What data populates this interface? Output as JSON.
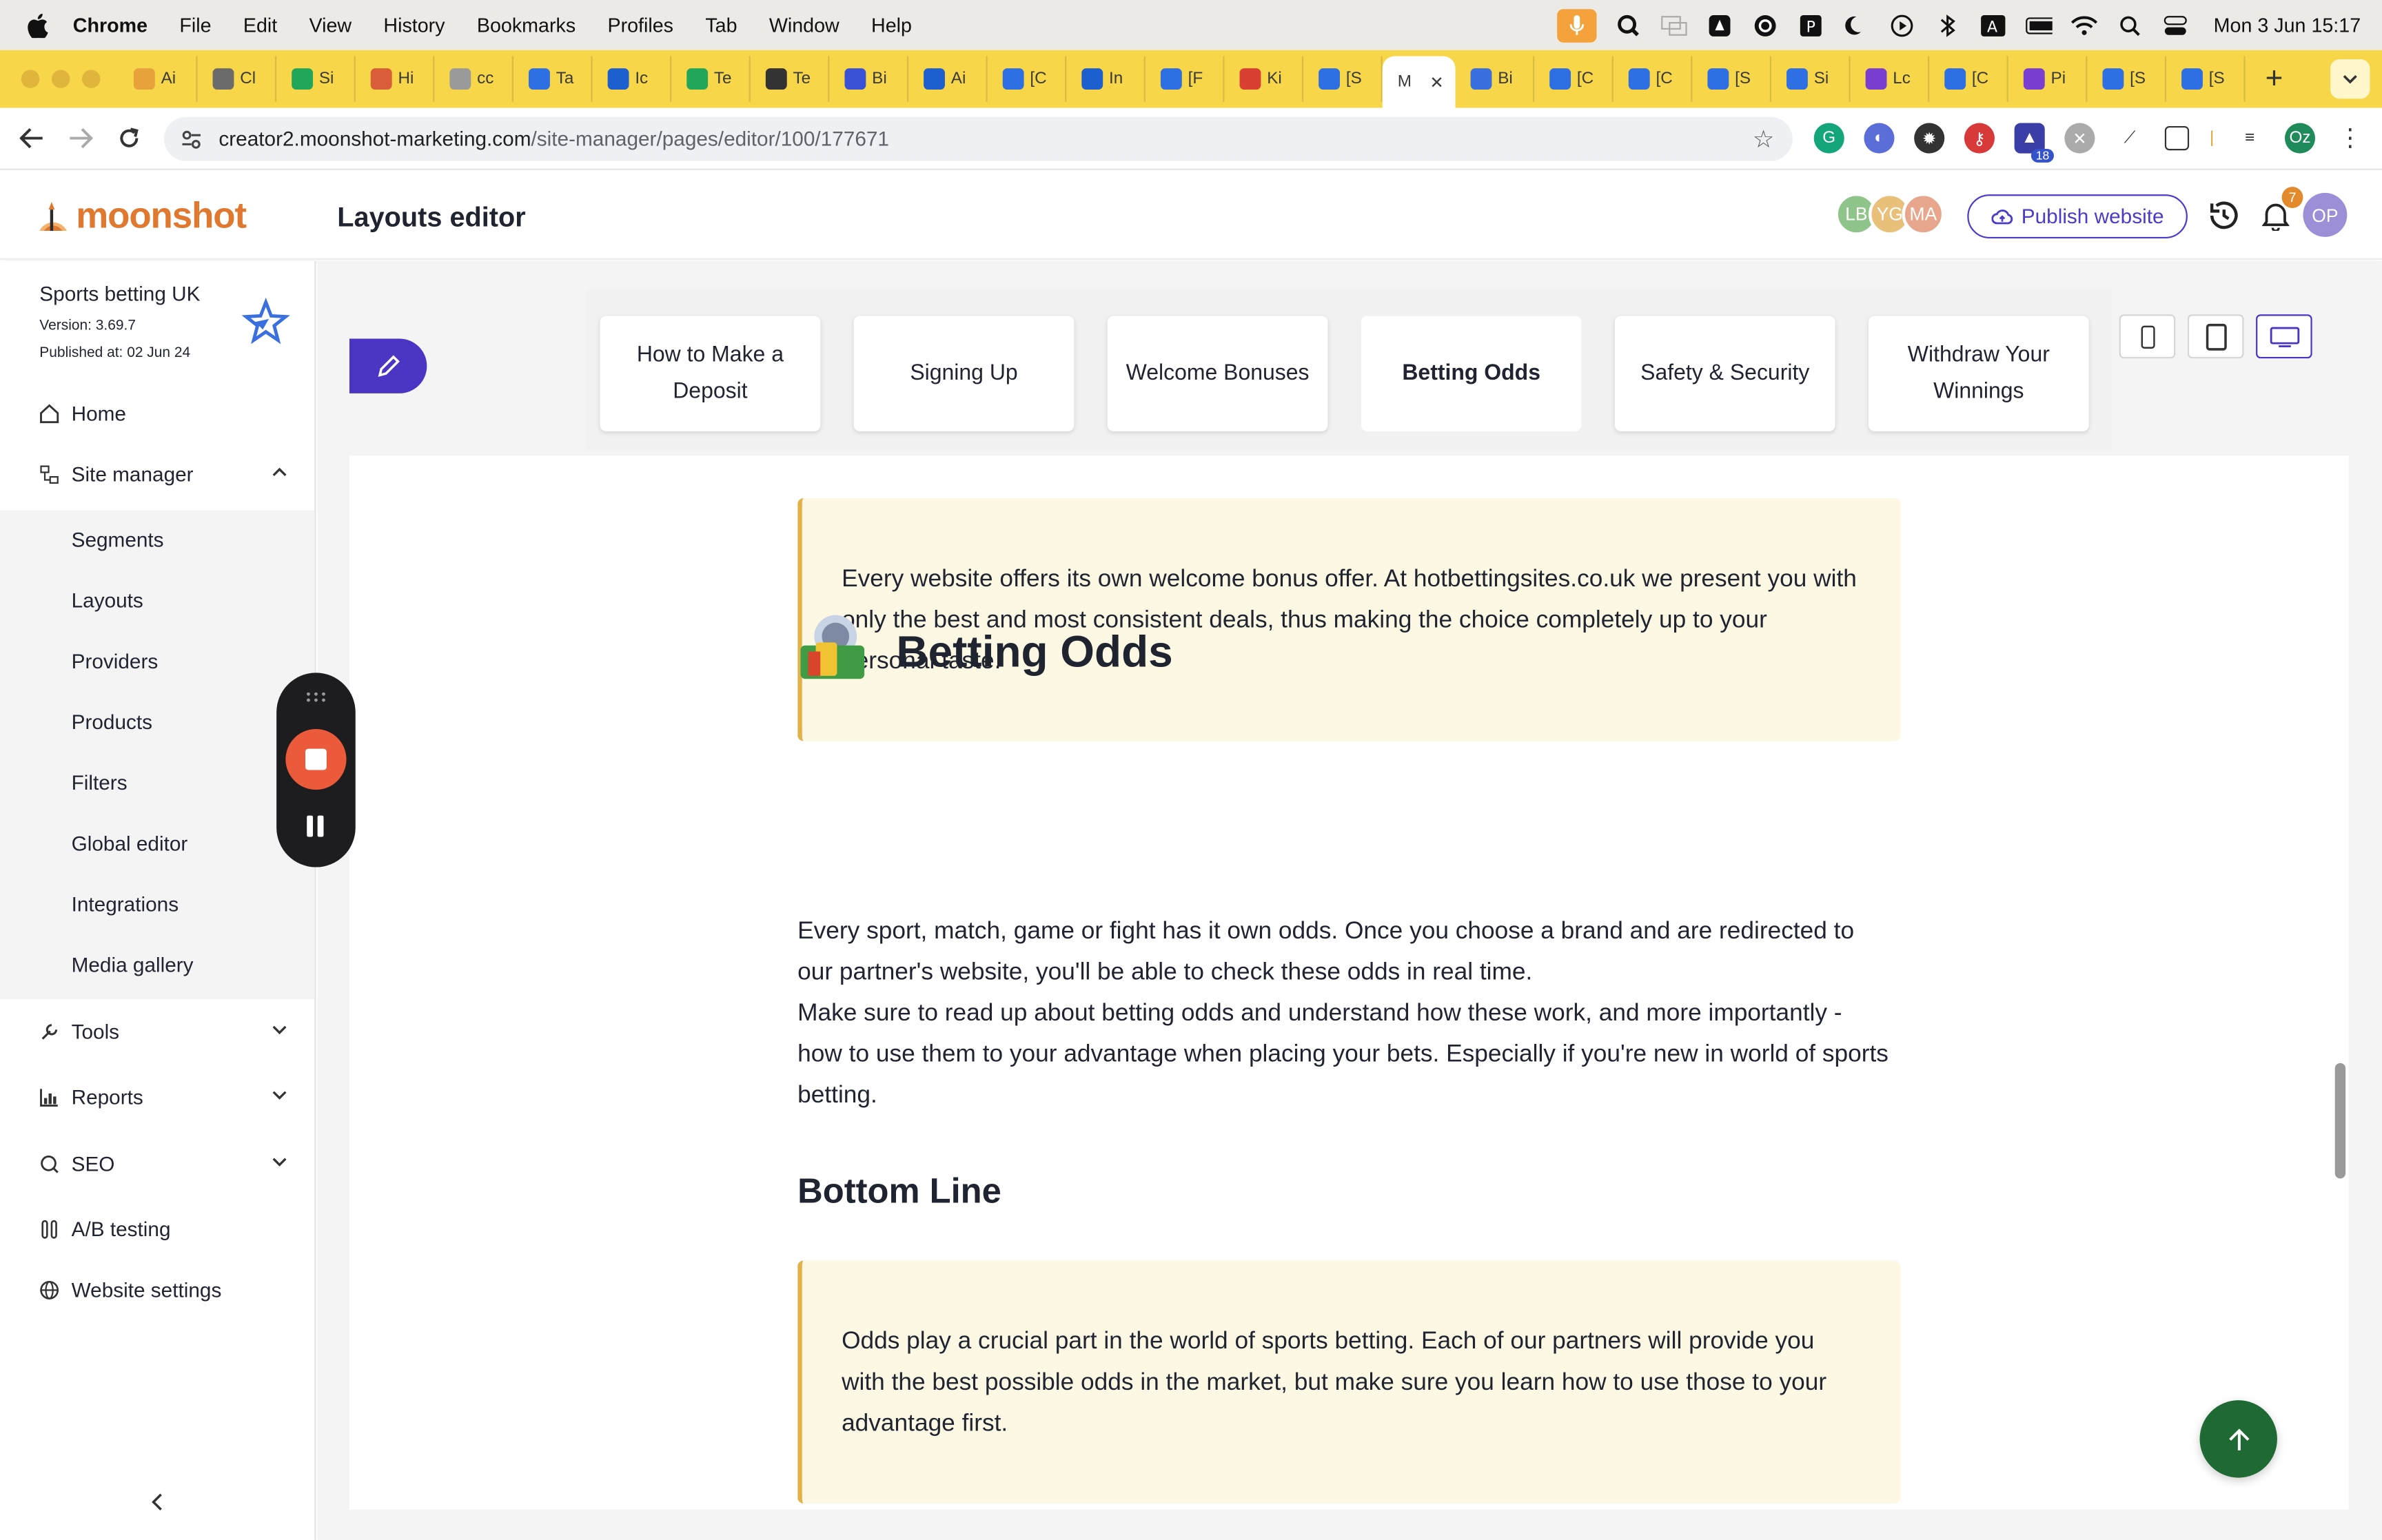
{
  "menubar": {
    "app": "Chrome",
    "items": [
      "File",
      "Edit",
      "View",
      "History",
      "Bookmarks",
      "Profiles",
      "Tab",
      "Window",
      "Help"
    ],
    "clock": "Mon 3 Jun  15:17"
  },
  "tabs": [
    {
      "label": "Ai",
      "color": "#e8a23b"
    },
    {
      "label": "Cl",
      "color": "#6b6b6b"
    },
    {
      "label": "Si",
      "color": "#22a65a"
    },
    {
      "label": "Hi",
      "color": "#d95d39"
    },
    {
      "label": "cc",
      "color": "#9a9a9a"
    },
    {
      "label": "Ta",
      "color": "#2f6fe4"
    },
    {
      "label": "Ic",
      "color": "#1e5fcf"
    },
    {
      "label": "Te",
      "color": "#22a65a"
    },
    {
      "label": "Te",
      "color": "#333333"
    },
    {
      "label": "Bi",
      "color": "#3a53d6"
    },
    {
      "label": "Ai",
      "color": "#1e5fcf"
    },
    {
      "label": "[C",
      "color": "#2f6fe4"
    },
    {
      "label": "In",
      "color": "#1e5fcf"
    },
    {
      "label": "[F",
      "color": "#2f6fe4"
    },
    {
      "label": "Ki",
      "color": "#d94032"
    },
    {
      "label": "[S",
      "color": "#2f6fe4"
    },
    {
      "label": "M",
      "color": "#ffffff",
      "active": true
    },
    {
      "label": "Bi",
      "color": "#3a6fe0"
    },
    {
      "label": "[C",
      "color": "#2f6fe4"
    },
    {
      "label": "[C",
      "color": "#2f6fe4"
    },
    {
      "label": "[S",
      "color": "#2f6fe4"
    },
    {
      "label": "Si",
      "color": "#2f6fe4"
    },
    {
      "label": "Lc",
      "color": "#7a3fd1"
    },
    {
      "label": "[C",
      "color": "#2f6fe4"
    },
    {
      "label": "Pi",
      "color": "#7a3fd1"
    },
    {
      "label": "[S",
      "color": "#2f6fe4"
    },
    {
      "label": "[S",
      "color": "#2f6fe4"
    }
  ],
  "address": {
    "host": "creator2.moonshot-marketing.com",
    "path": "/site-manager/pages/editor/100/177671"
  },
  "extensions": {
    "badge_count": "18",
    "profile_initials": "Oz"
  },
  "header": {
    "logo_text": "moonshot",
    "title": "Layouts editor",
    "collaborators": [
      {
        "initials": "LB",
        "color": "#8fc48a"
      },
      {
        "initials": "YG",
        "color": "#e8c07a"
      },
      {
        "initials": "MA",
        "color": "#e8a78c"
      }
    ],
    "publish_label": "Publish website",
    "notification_count": "7",
    "user_initials": "OP"
  },
  "sidebar": {
    "site_name": "Sports betting UK",
    "version": "Version: 3.69.7",
    "published": "Published at: 02 Jun 24",
    "items": [
      {
        "label": "Home",
        "icon": "home-icon"
      },
      {
        "label": "Site manager",
        "icon": "sitemap-icon",
        "expanded": true
      },
      {
        "label": "Tools",
        "icon": "wrench-icon"
      },
      {
        "label": "Reports",
        "icon": "bar-chart-icon"
      },
      {
        "label": "SEO",
        "icon": "search-chat-icon"
      },
      {
        "label": "A/B testing",
        "icon": "flask-icon"
      },
      {
        "label": "Website settings",
        "icon": "globe-icon"
      }
    ],
    "sub_items": [
      "Segments",
      "Layouts",
      "Providers",
      "Products",
      "Filters",
      "Global editor",
      "Integrations",
      "Media gallery"
    ]
  },
  "editor": {
    "section_tabs": [
      {
        "label": "How to Make a Deposit"
      },
      {
        "label": "Signing Up"
      },
      {
        "label": "Welcome Bonuses"
      },
      {
        "label": "Betting Odds",
        "active": true
      },
      {
        "label": "Safety & Security"
      },
      {
        "label": "Withdraw Your Winnings"
      }
    ],
    "callout_1": "Every website offers its own welcome bonus offer. At hotbettingsites.co.uk we present you with only the best and most consistent deals, thus making the choice completely up to your personal taste.",
    "odds_heading": "Betting Odds",
    "odds_para_1": "Every sport, match, game or fight has it own odds. Once you choose a brand and are redirected to our partner's website, you'll be able to check these odds in real time.",
    "odds_para_2": "Make sure to read up about betting odds and understand how these work, and more importantly - how to use them to your advantage when placing your bets. Especially if you're new in world of sports betting.",
    "bottom_heading": "Bottom Line",
    "callout_2": "Odds play a crucial part in the world of sports betting. Each of our partners will provide you with the best possible odds in the market, but make sure you learn how to use those to your advantage first."
  }
}
